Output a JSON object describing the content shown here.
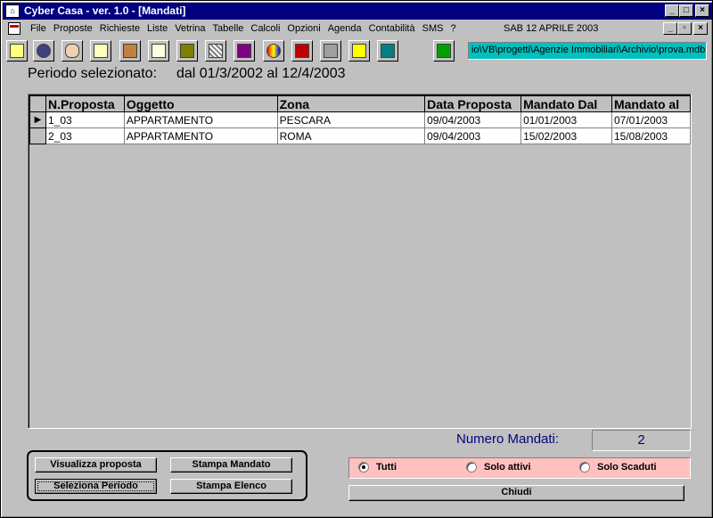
{
  "window": {
    "title": "Cyber Casa - ver. 1.0 - [Mandati]"
  },
  "menu": {
    "items": [
      "File",
      "Proposte",
      "Richieste",
      "Liste",
      "Vetrina",
      "Tabelle",
      "Calcoli",
      "Opzioni",
      "Agenda",
      "Contabilità",
      "SMS",
      "?"
    ],
    "date": "SAB 12 APRILE 2003"
  },
  "toolbar": {
    "icons": [
      "folder-icon",
      "eye-icon",
      "ear-icon",
      "document-icon",
      "person-icon",
      "note-icon",
      "monitor-icon",
      "grid-icon",
      "chart-icon",
      "colors-icon",
      "book-icon",
      "trash-icon",
      "label-icon",
      "building-icon",
      "phone-icon"
    ],
    "path": "io\\VB\\progetti\\Agenzie Immobiliari\\Archivio\\prova.mdb"
  },
  "period": {
    "label": "Periodo selezionato:",
    "range": "dal 01/3/2002 al 12/4/2003"
  },
  "table": {
    "headers": [
      "N.Proposta",
      "Oggetto",
      "Zona",
      "Data Proposta",
      "Mandato Dal",
      "Mandato al"
    ],
    "rows": [
      [
        "1_03",
        "APPARTAMENTO",
        "PESCARA",
        "09/04/2003",
        "01/01/2003",
        "07/01/2003"
      ],
      [
        "2_03",
        "APPARTAMENTO",
        "ROMA",
        "09/04/2003",
        "15/02/2003",
        "15/08/2003"
      ]
    ]
  },
  "count": {
    "label": "Numero Mandati:",
    "value": "2"
  },
  "buttons": {
    "visualizza": "Visualizza proposta",
    "stampa_mandato": "Stampa Mandato",
    "seleziona_periodo": "Seleziona Periodo",
    "stampa_elenco": "Stampa Elenco",
    "chiudi": "Chiudi"
  },
  "filter": {
    "options": [
      "Tutti",
      "Solo attivi",
      "Solo Scaduti"
    ],
    "selected": "Tutti"
  },
  "colors": {
    "titlebar": "#000080",
    "path_bg": "#00c0c0",
    "filter_bg": "#ffc0c0",
    "count_text": "#000080"
  }
}
